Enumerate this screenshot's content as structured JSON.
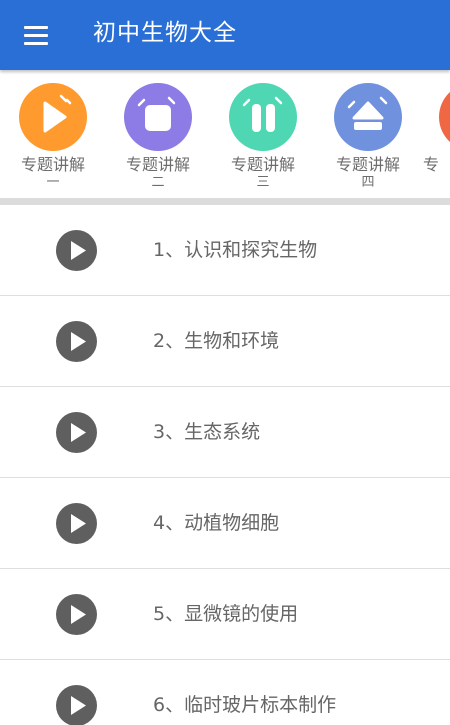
{
  "app": {
    "title": "初中生物大全"
  },
  "topics": [
    {
      "label": "专题讲解",
      "num": "一",
      "color": "#ff9a2e",
      "icon": "play-triangle-icon"
    },
    {
      "label": "专题讲解",
      "num": "二",
      "color": "#8d7be6",
      "icon": "square-stop-icon"
    },
    {
      "label": "专题讲解",
      "num": "三",
      "color": "#4ed7b2",
      "icon": "pause-bars-icon"
    },
    {
      "label": "专题讲解",
      "num": "四",
      "color": "#6f91de",
      "icon": "eject-icon"
    },
    {
      "label": "专",
      "num": "",
      "color": "#ef6743",
      "icon": "partial-topic-icon"
    }
  ],
  "lessons": [
    {
      "title": "1、认识和探究生物"
    },
    {
      "title": "2、生物和环境"
    },
    {
      "title": "3、生态系统"
    },
    {
      "title": "4、动植物细胞"
    },
    {
      "title": "5、显微镜的使用"
    },
    {
      "title": "6、临时玻片标本制作"
    }
  ],
  "colors": {
    "header": "#2a6fd6",
    "play_button": "#5f5f5f",
    "text": "#666666"
  }
}
